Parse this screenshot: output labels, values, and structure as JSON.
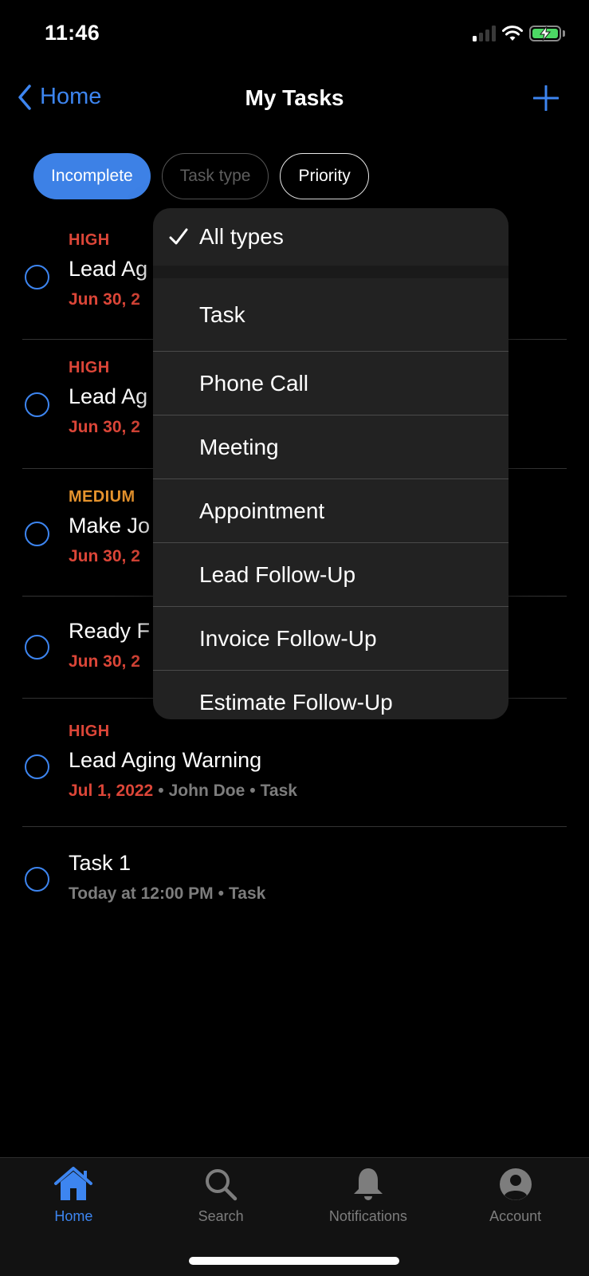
{
  "status_bar": {
    "time": "11:46",
    "signal_bars_active": 1,
    "signal_bars_total": 4,
    "battery_charging": true,
    "icons": [
      "signal-icon",
      "wifi-icon",
      "battery-charging-icon"
    ]
  },
  "nav": {
    "back_label": "Home",
    "title": "My Tasks",
    "add_icon": "plus-icon"
  },
  "filters": [
    {
      "label": "Incomplete",
      "state": "active"
    },
    {
      "label": "Task type",
      "state": "open"
    },
    {
      "label": "Priority",
      "state": "default"
    }
  ],
  "tasks": [
    {
      "priority": "HIGH",
      "title": "Lead Ag",
      "date": "Jun 30, 2",
      "meta_rest": ""
    },
    {
      "priority": "HIGH",
      "title": "Lead Ag",
      "date": "Jun 30, 2",
      "meta_rest": ""
    },
    {
      "priority": "MEDIUM",
      "title": "Make Jo",
      "date": "Jun 30, 2",
      "meta_rest": ""
    },
    {
      "priority": "",
      "title": "Ready F",
      "date": "Jun 30, 2",
      "meta_rest": ""
    },
    {
      "priority": "HIGH",
      "title": "Lead Aging Warning",
      "date": "Jul 1, 2022",
      "assignee": "John Doe",
      "type": "Task"
    },
    {
      "priority": "",
      "title": "Task 1",
      "date": "Today at 12:00 PM",
      "type": "Task"
    }
  ],
  "task_type_menu": {
    "selected": "All types",
    "options": [
      "All types",
      "Task",
      "Phone Call",
      "Meeting",
      "Appointment",
      "Lead Follow-Up",
      "Invoice Follow-Up",
      "Estimate Follow-Up"
    ]
  },
  "tab_bar": {
    "tabs": [
      {
        "label": "Home",
        "icon": "home-icon",
        "active": true
      },
      {
        "label": "Search",
        "icon": "search-icon",
        "active": false
      },
      {
        "label": "Notifications",
        "icon": "bell-icon",
        "active": false
      },
      {
        "label": "Account",
        "icon": "account-icon",
        "active": false
      }
    ]
  },
  "colors": {
    "accent": "#3d85f0",
    "high": "#dc4638",
    "medium": "#e5932d",
    "muted": "#7d7d7d"
  }
}
